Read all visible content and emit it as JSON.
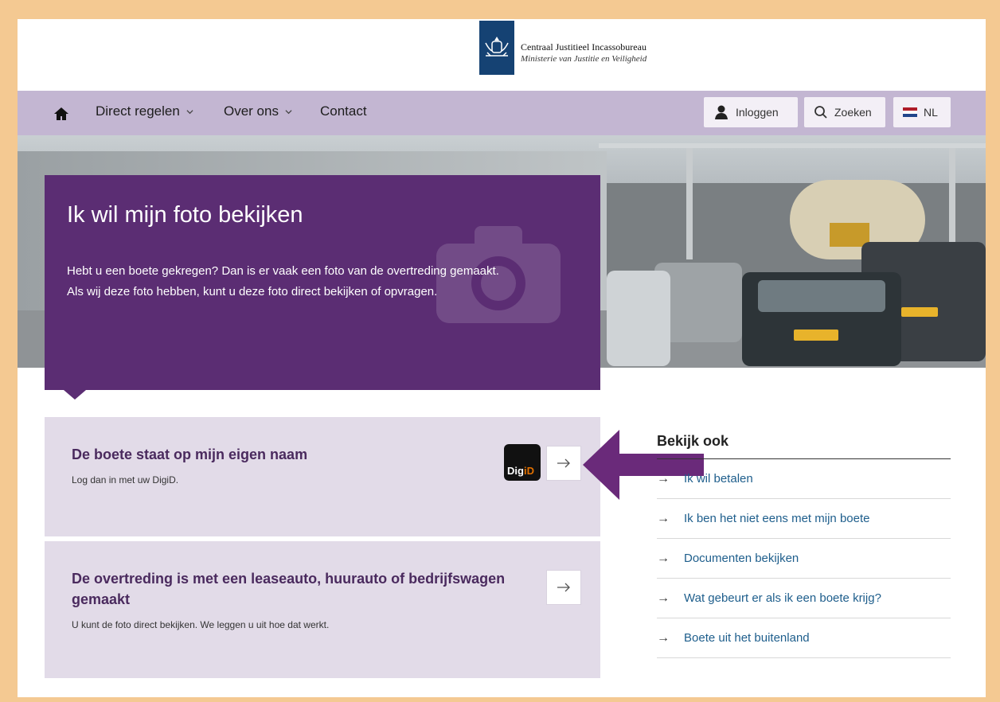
{
  "header": {
    "org_name": "Centraal Justitieel Incassobureau",
    "org_sub": "Ministerie van Justitie en Veiligheid"
  },
  "nav": {
    "home_icon": "home-icon",
    "items": [
      {
        "label": "Direct regelen"
      },
      {
        "label": "Over ons"
      },
      {
        "label": "Contact"
      }
    ],
    "login_label": "Inloggen",
    "search_label": "Zoeken",
    "language_label": "NL"
  },
  "hero": {
    "title": "Ik wil mijn foto bekijken",
    "text": "Hebt u een boete gekregen? Dan is er vaak een foto van de overtreding gemaakt. Als wij deze foto hebben, kunt u deze foto direct bekijken of opvragen."
  },
  "cards": [
    {
      "title": "De boete staat op mijn eigen naam",
      "subtitle": "Log dan in met uw DigiD.",
      "badge_left": "Dig",
      "badge_right": "iD"
    },
    {
      "title": "De overtreding is met een leaseauto, huurauto of bedrijfswagen gemaakt",
      "subtitle": "U kunt de foto direct bekijken. We leggen u uit hoe dat werkt."
    }
  ],
  "sidebar": {
    "title": "Bekijk ook",
    "links": [
      {
        "label": "Ik wil betalen"
      },
      {
        "label": "Ik ben het niet eens met mijn boete"
      },
      {
        "label": "Documenten bekijken"
      },
      {
        "label": "Wat gebeurt er als ik een boete krijg?"
      },
      {
        "label": "Boete uit het buitenland"
      }
    ]
  },
  "colors": {
    "hero_panel": "#5b2d73",
    "nav_bar": "#c3b6d2",
    "card_bg": "#e2dbe8",
    "link": "#1e5e8c",
    "annotation_arrow": "#6a2a7a",
    "frame_border": "#f4c992"
  }
}
